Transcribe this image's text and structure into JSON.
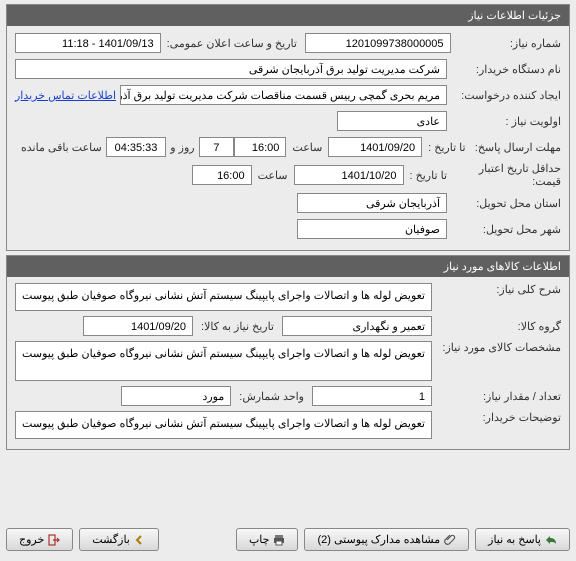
{
  "panel_need": {
    "title": "جزئیات اطلاعات نیاز",
    "labels": {
      "need_no": "شماره نیاز:",
      "announce_dt": "تاریخ و ساعت اعلان عمومی:",
      "buyer_org": "نام دستگاه خریدار:",
      "creator": "ایجاد کننده درخواست:",
      "priority": "اولویت نیاز :",
      "reply_deadline": "مهلت ارسال پاسخ:",
      "min_validity": "حداقل تاریخ اعتبار قیمت:",
      "delivery_province": "استان محل تحویل:",
      "delivery_city": "شهر محل تحویل:",
      "to_date": "تا تاریخ :",
      "hour": "ساعت",
      "days_and": "روز و",
      "hours_remaining": "ساعت باقی مانده",
      "contact_link": "اطلاعات تماس خریدار"
    },
    "values": {
      "need_no": "1201099738000005",
      "announce_dt": "1401/09/13 - 11:18",
      "buyer_org": "شرکت مدیریت تولید برق آذربایجان شرقی",
      "creator": "مریم بحری گمچی رییس قسمت مناقصات شرکت مدیریت تولید برق آذربایجان شرق",
      "priority": "عادی",
      "reply_to_date": "1401/09/20",
      "reply_to_time": "16:00",
      "days_remaining": "7",
      "time_remaining": "04:35:33",
      "validity_to_date": "1401/10/20",
      "validity_to_time": "16:00",
      "province": "آذربایجان شرقی",
      "city": "صوفیان"
    }
  },
  "panel_items": {
    "title": "اطلاعات کالاهای مورد نیاز",
    "labels": {
      "general_desc": "شرح کلی نیاز:",
      "goods_group": "گروه کالا:",
      "need_by_date": "تاریخ نیاز به کالا:",
      "item_spec": "مشخصات کالای مورد نیاز:",
      "qty": "تعداد / مقدار نیاز:",
      "unit": "واحد شمارش:",
      "buyer_notes": "توضیحات خریدار:"
    },
    "values": {
      "general_desc": "تعویض لوله ها و اتصالات واجرای پایپینگ سیستم آتش نشانی نیروگاه صوفیان طبق پیوست",
      "goods_group": "تعمیر و نگهداری",
      "need_by_date": "1401/09/20",
      "item_spec": "تعویض لوله ها و اتصالات واجرای پایپینگ سیستم آتش نشانی نیروگاه صوفیان طبق پیوست",
      "qty": "1",
      "unit": "مورد",
      "buyer_notes": "تعویض لوله ها و اتصالات واجرای پایپینگ سیستم آتش نشانی نیروگاه صوفیان طبق پیوست"
    }
  },
  "buttons": {
    "reply": "پاسخ به نیاز",
    "attachments": "مشاهده مدارک پیوستی (2)",
    "print": "چاپ",
    "back": "بازگشت",
    "exit": "خروج"
  }
}
